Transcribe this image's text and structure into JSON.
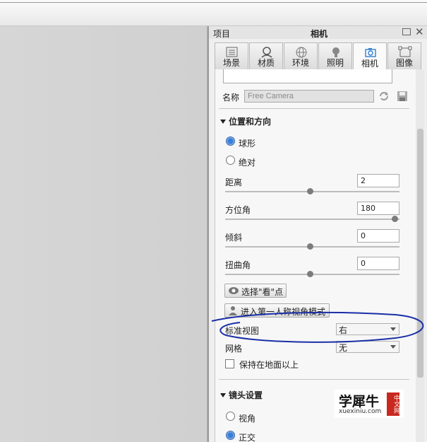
{
  "panel": {
    "title_left": "项目",
    "title_center": "相机",
    "tabs": [
      {
        "label": "场景",
        "icon": "scene-icon"
      },
      {
        "label": "材质",
        "icon": "material-icon"
      },
      {
        "label": "环境",
        "icon": "environment-icon"
      },
      {
        "label": "照明",
        "icon": "lighting-icon"
      },
      {
        "label": "相机",
        "icon": "camera-icon",
        "active": true
      },
      {
        "label": "图像",
        "icon": "image-icon"
      }
    ]
  },
  "camera": {
    "name_label": "名称",
    "name_value": "Free Camera"
  },
  "position": {
    "header": "位置和方向",
    "radio_sphere": "球形",
    "radio_absolute": "绝对",
    "distance_label": "距离",
    "distance_value": "2",
    "distance_slider": 0.5,
    "azimuth_label": "方位角",
    "azimuth_value": "180",
    "azimuth_slider": 1.0,
    "tilt_label": "倾斜",
    "tilt_value": "0",
    "tilt_slider": 0.5,
    "twist_label": "扭曲角",
    "twist_value": "0",
    "twist_slider": 0.5,
    "lookat_button": "选择\"看\"点",
    "firstperson_button": "进入第一人称视角模式",
    "standard_view_label": "标准视图",
    "standard_view_value": "右",
    "grid_label": "网格",
    "grid_value": "无",
    "keep_above_label": "保持在地面以上"
  },
  "lens": {
    "header": "镜头设置",
    "radio_perspective": "视角",
    "radio_ortho": "正交"
  },
  "watermark": {
    "brand": "学犀牛",
    "domain": "xuexiniu.com",
    "badge": "中文网"
  },
  "colors": {
    "annotation": "#1b2fa6",
    "radio_active": "#3a7fd8"
  }
}
